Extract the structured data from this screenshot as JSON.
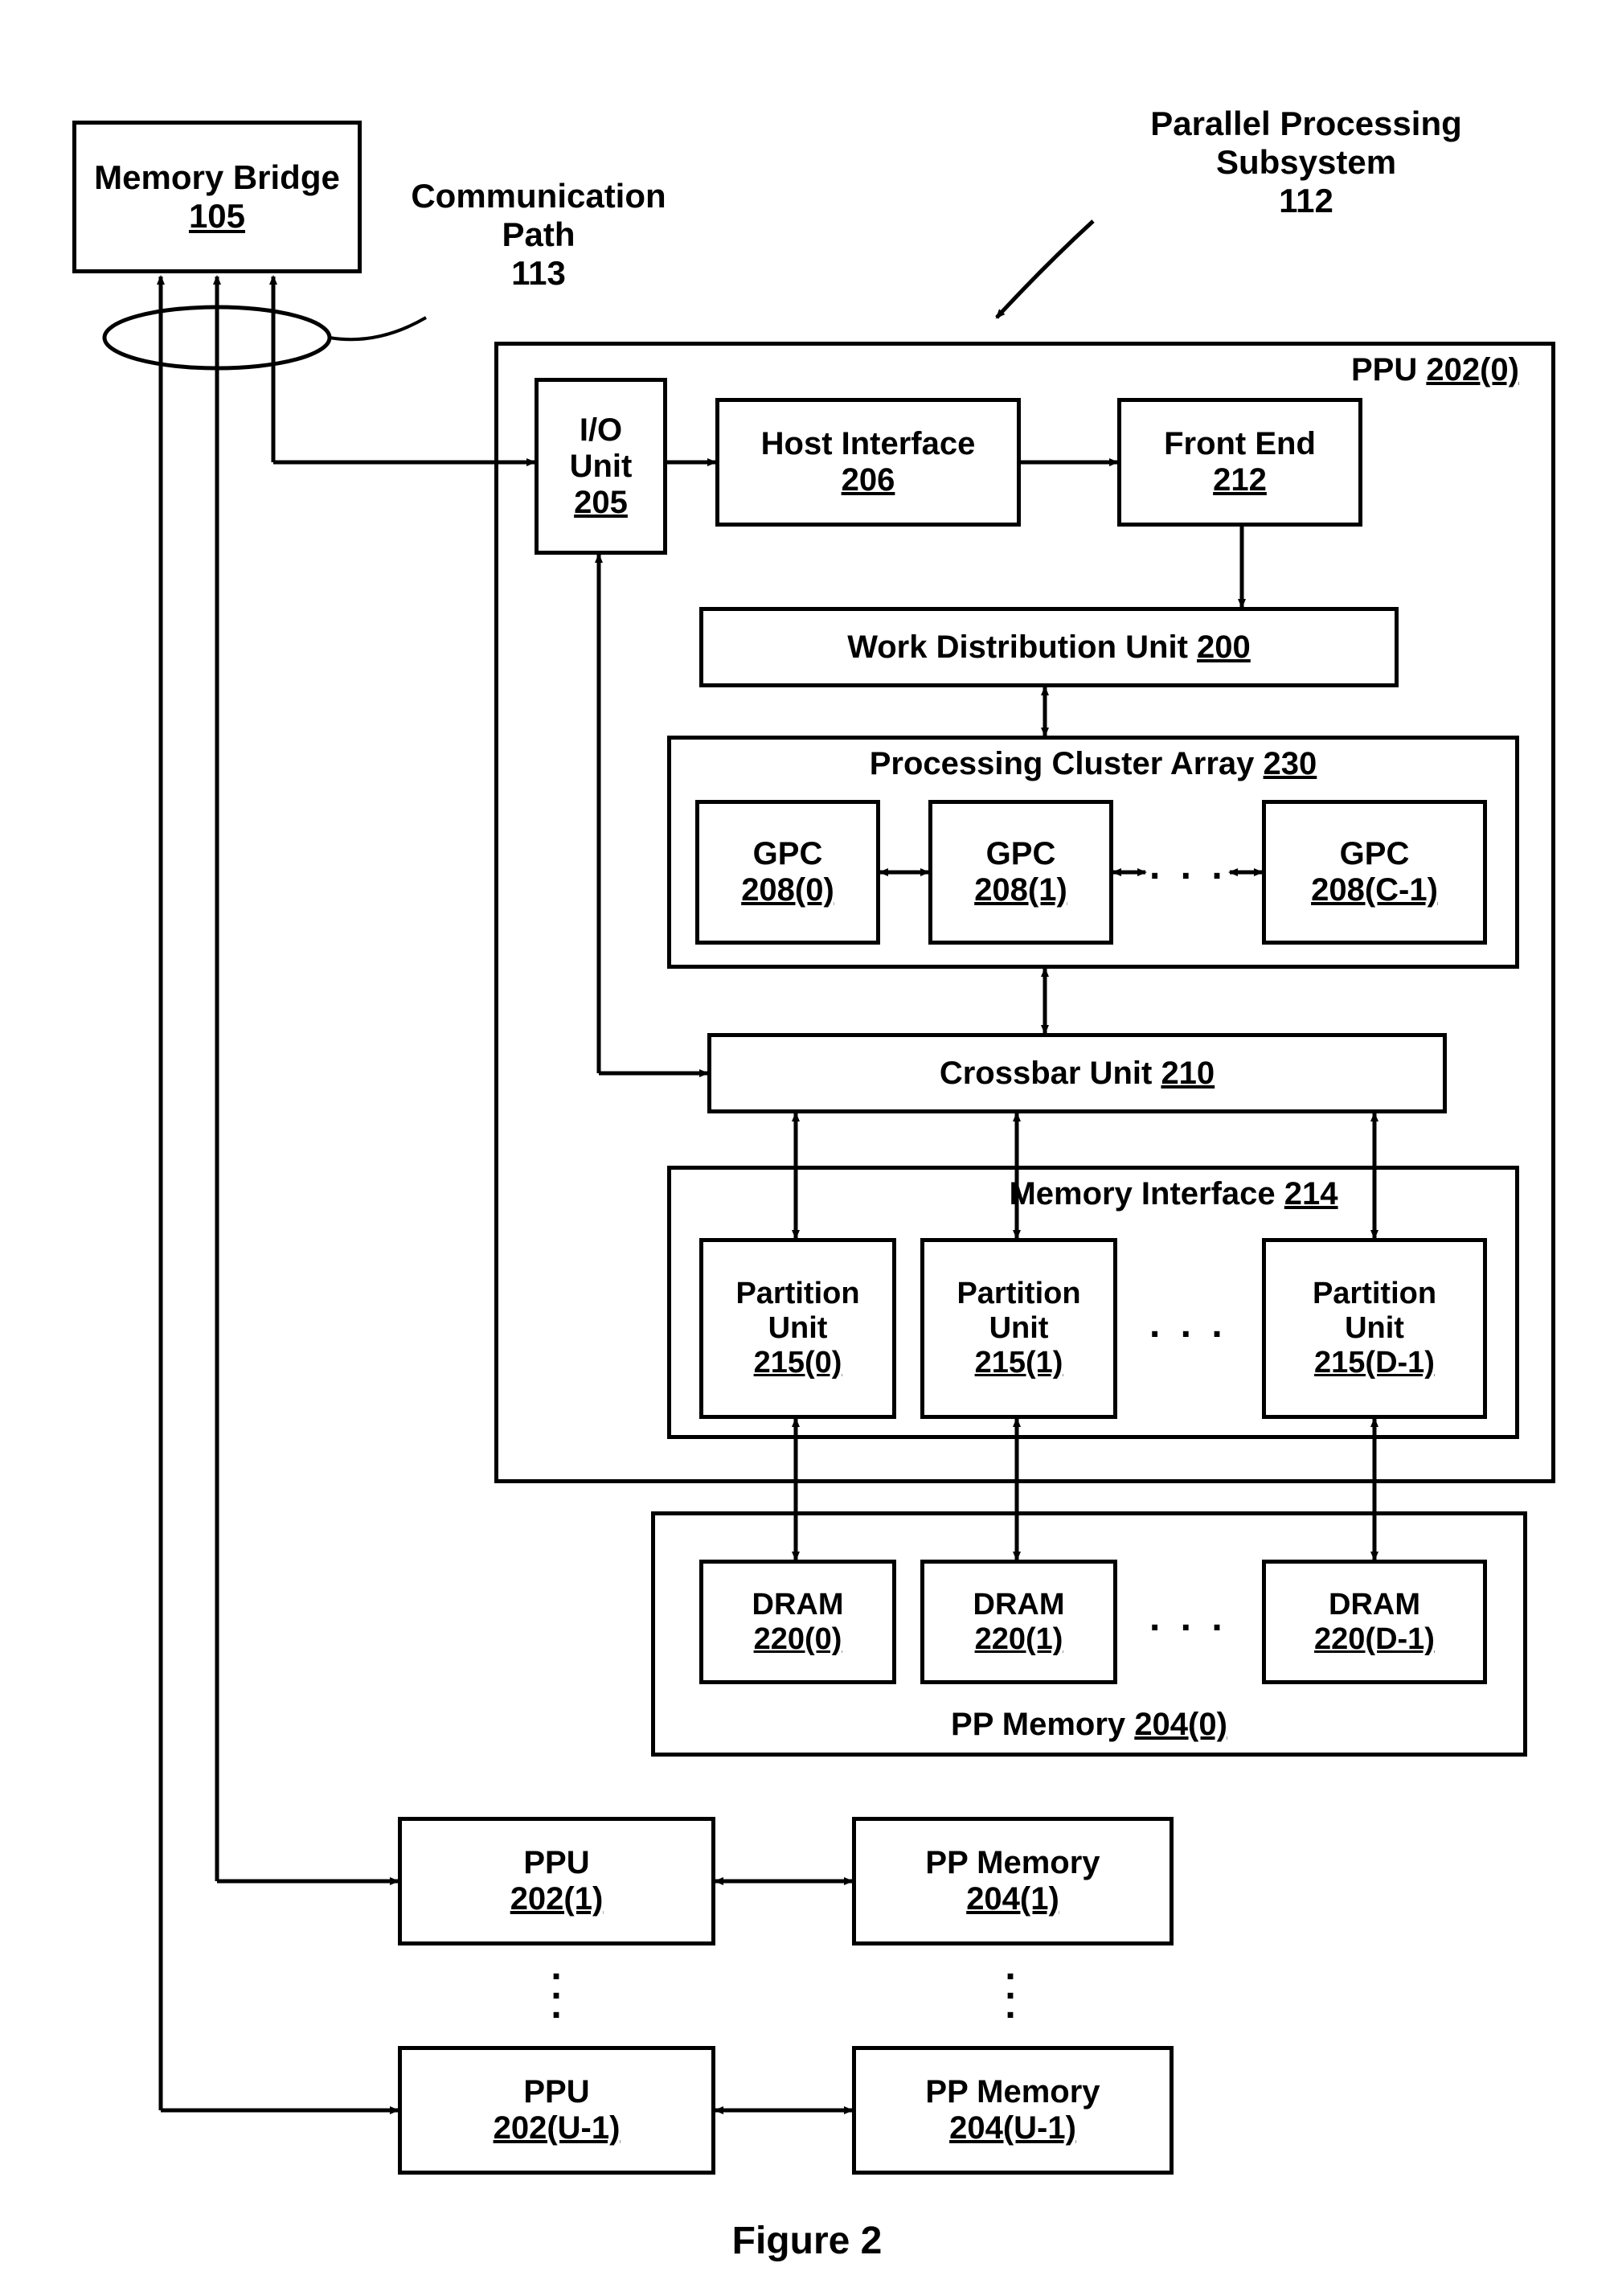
{
  "labels": {
    "memory_bridge": {
      "title": "Memory Bridge",
      "num": "105"
    },
    "comm_path": {
      "title": "Communication Path",
      "num": "113"
    },
    "pps": {
      "title": "Parallel Processing Subsystem",
      "num": "112"
    },
    "ppu0": {
      "title": "PPU",
      "num": "202(0)"
    },
    "io_unit": {
      "title": "I/O Unit",
      "num": "205"
    },
    "host_interface": {
      "title": "Host Interface",
      "num": "206"
    },
    "front_end": {
      "title": "Front End",
      "num": "212"
    },
    "work_dist": {
      "title": "Work Distribution Unit",
      "num": "200"
    },
    "pca": {
      "title": "Processing Cluster Array",
      "num": "230"
    },
    "gpc0": {
      "title": "GPC",
      "num": "208(0)"
    },
    "gpc1": {
      "title": "GPC",
      "num": "208(1)"
    },
    "gpcC": {
      "title": "GPC",
      "num": "208(C-1)"
    },
    "crossbar": {
      "title": "Crossbar Unit",
      "num": "210"
    },
    "mem_interface": {
      "title": "Memory Interface",
      "num": "214"
    },
    "part0": {
      "line1": "Partition",
      "line2": "Unit",
      "num": "215(0)"
    },
    "part1": {
      "line1": "Partition",
      "line2": "Unit",
      "num": "215(1)"
    },
    "partD": {
      "line1": "Partition",
      "line2": "Unit",
      "num": "215(D-1)"
    },
    "ppmem": {
      "title": "PP Memory",
      "num": "204(0)"
    },
    "dram0": {
      "title": "DRAM",
      "num": "220(0)"
    },
    "dram1": {
      "title": "DRAM",
      "num": "220(1)"
    },
    "dramD": {
      "title": "DRAM",
      "num": "220(D-1)"
    },
    "ppu1": {
      "title": "PPU",
      "num": "202(1)"
    },
    "ppm1": {
      "title": "PP Memory",
      "num": "204(1)"
    },
    "ppuU": {
      "title": "PPU",
      "num": "202(U-1)"
    },
    "ppmU": {
      "title": "PP Memory",
      "num": "204(U-1)"
    },
    "figure": "Figure 2"
  }
}
